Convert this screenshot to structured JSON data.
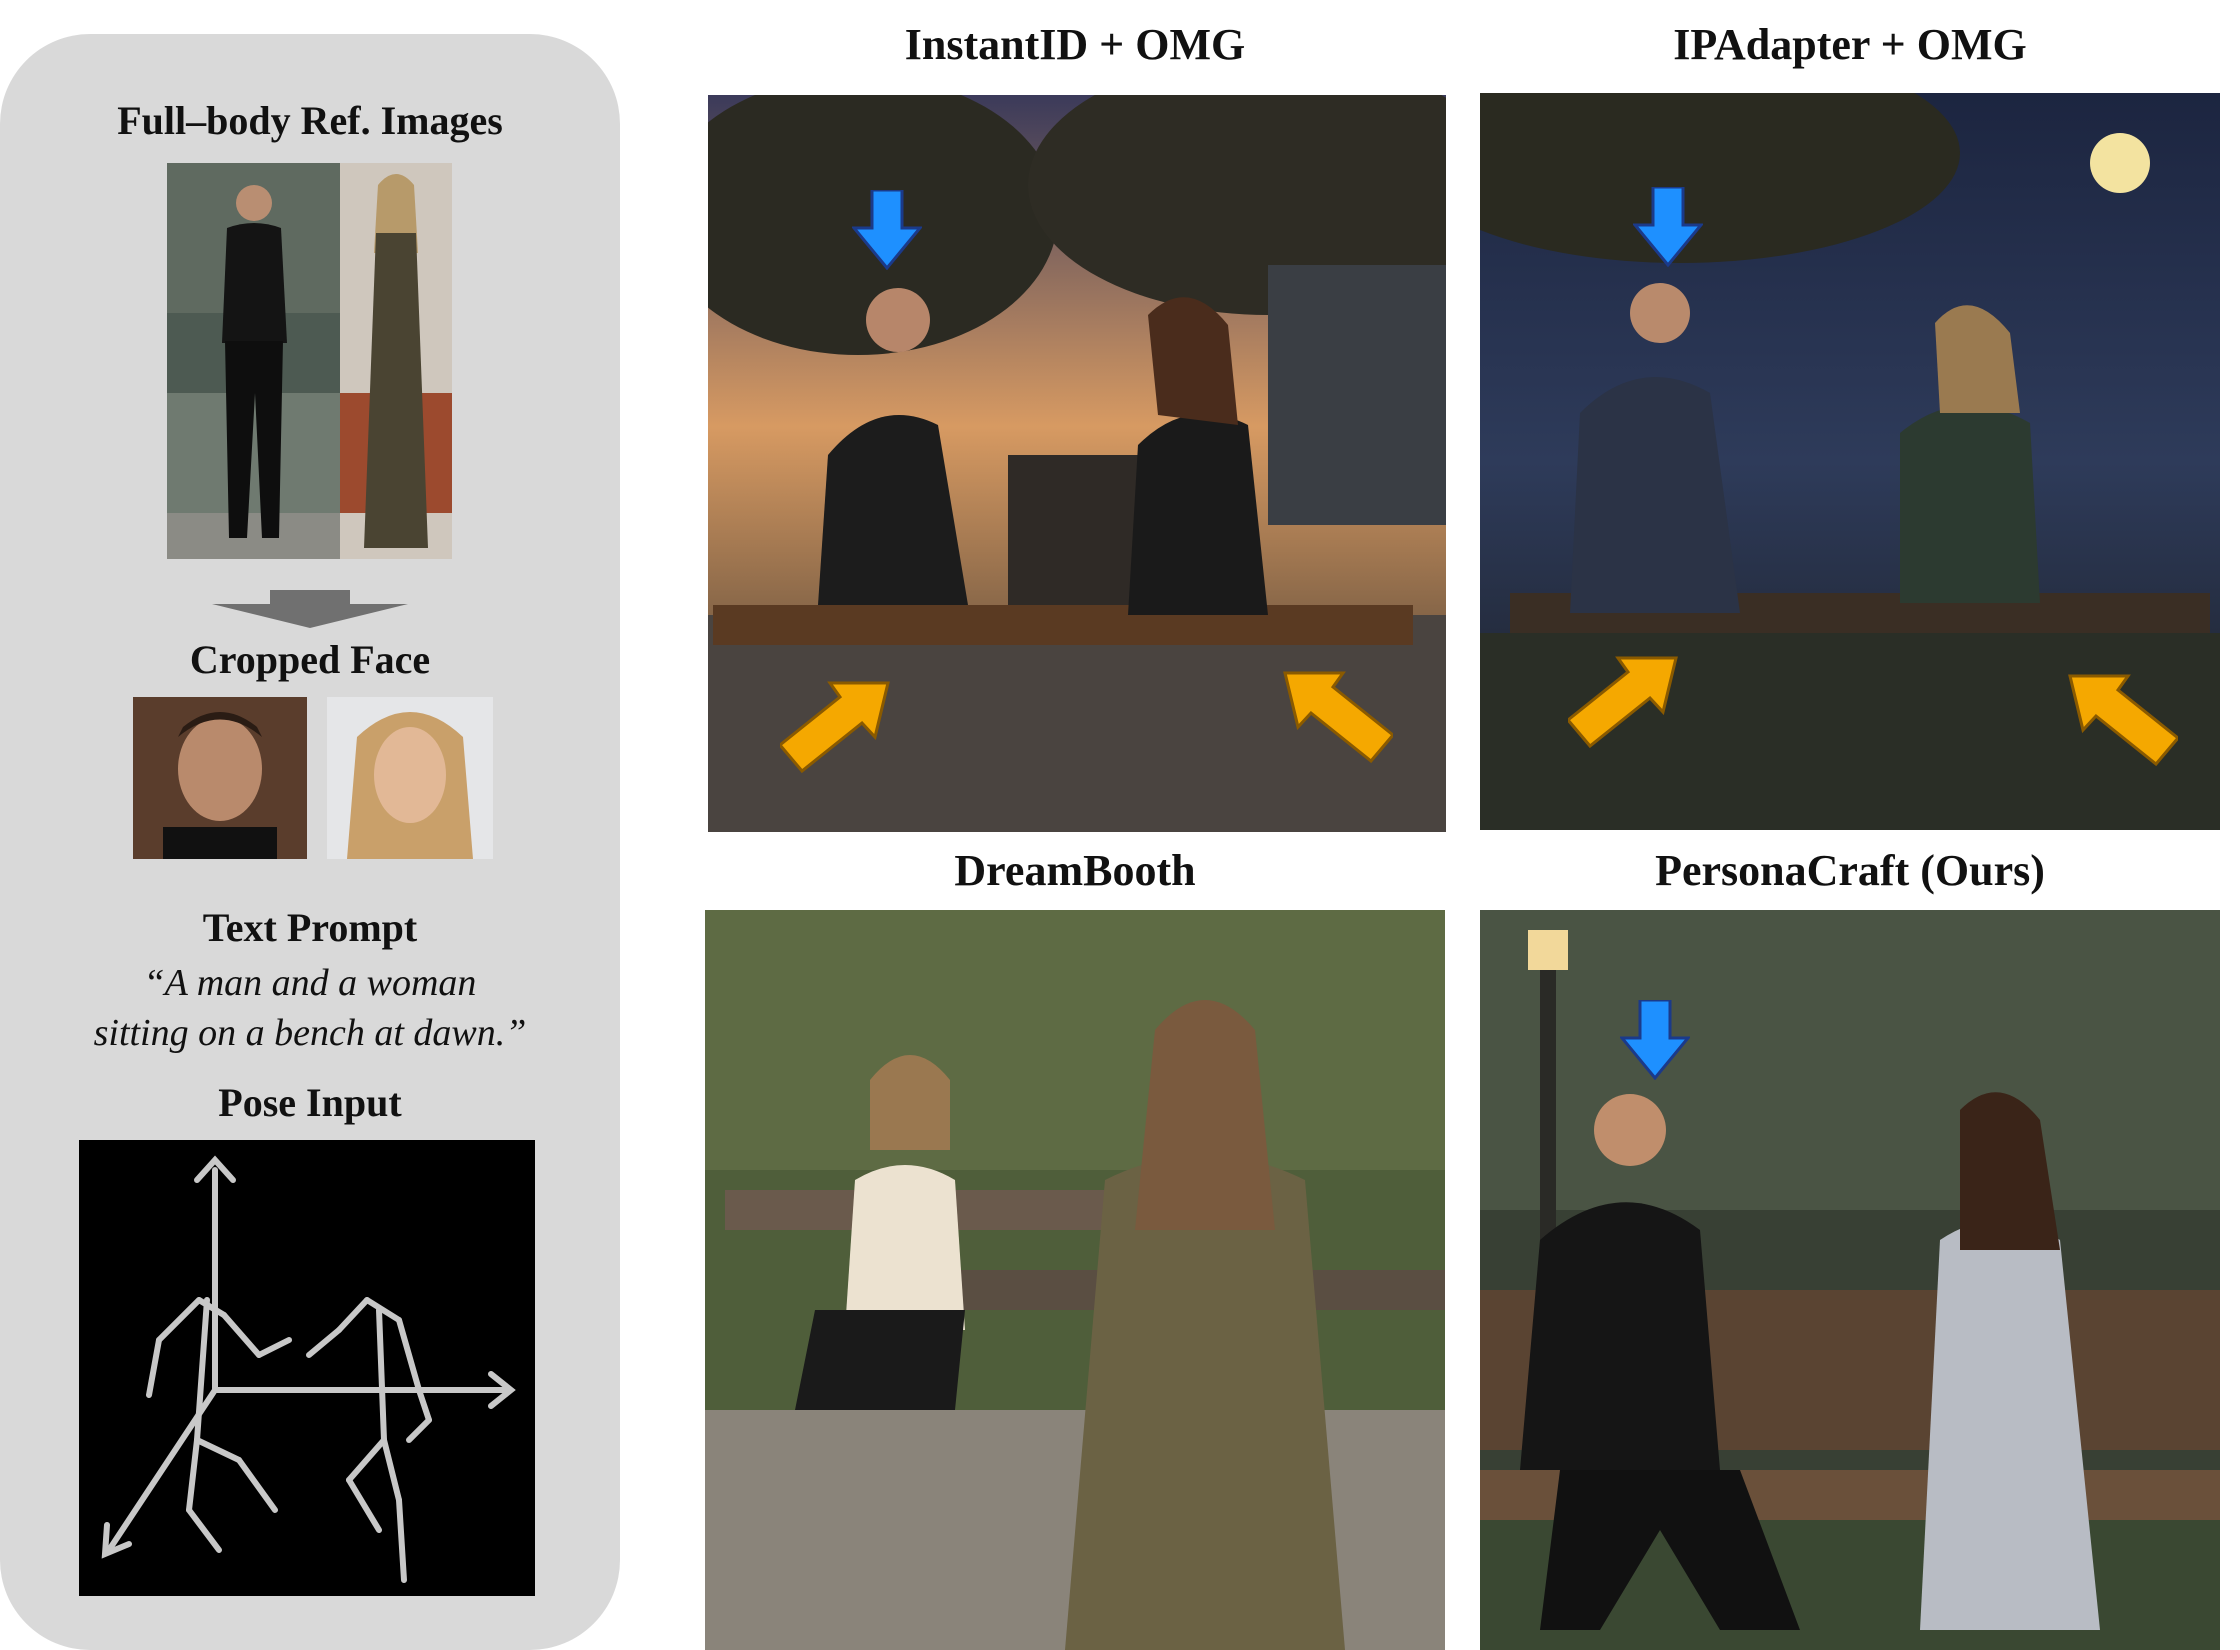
{
  "inputs": {
    "ref_heading": "Full–body Ref. Images",
    "face_heading": "Cropped Face",
    "prompt_heading": "Text Prompt",
    "prompt_line1": "“A man and a woman",
    "prompt_line2": "sitting on a bench at dawn.”",
    "pose_heading": "Pose Input"
  },
  "results": {
    "top_left_title": "InstantID + OMG",
    "top_right_title": "IPAdapter + OMG",
    "bottom_left_title": "DreamBooth",
    "bottom_right_title": "PersonaCraft (Ours)"
  },
  "colors": {
    "panel": "#d9d9d9",
    "arrow_blue": "#1e90ff",
    "arrow_orange": "#f5a800",
    "process_arrow": "#707070"
  }
}
